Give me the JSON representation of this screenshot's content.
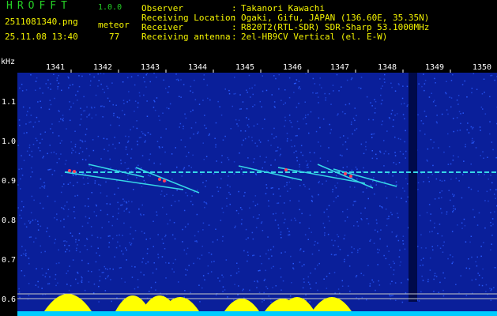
{
  "header": {
    "app_name": "HROFFT",
    "version": "1.0.0",
    "filename": "2511081340.png",
    "timestamp": "25.11.08 13:40",
    "meteor_label": "meteor",
    "meteor_count": "77",
    "info_labels": [
      "Observer",
      "Receiving Location",
      "Receiver",
      "Receiving antenna"
    ],
    "info_colons": [
      ":",
      ":",
      ":",
      ":"
    ],
    "info_values": [
      "Takanori Kawachi",
      "Ogaki, Gifu, JAPAN (136.60E, 35.35N)",
      "R820T2(RTL-SDR) SDR-Sharp 53.1000MHz",
      "2el-HB9CV Vertical (el. E-W)"
    ]
  },
  "spectrogram": {
    "y_unit": "kHz",
    "y_ticks": [
      "1.1",
      "1.0",
      "0.9",
      "0.8",
      "0.7",
      "0.6"
    ],
    "x_ticks": [
      "1341",
      "1342",
      "1343",
      "1344",
      "1345",
      "1346",
      "1347",
      "1348",
      "1349",
      "1350"
    ],
    "colors": {
      "background": "#0a1f9a",
      "noise": "#2a5cff",
      "trace": "#36d6e6",
      "hot": "#ff3c5a",
      "panel": "#f4f400",
      "spectrum": "#ffff00",
      "floor": "#00ccff"
    }
  }
}
